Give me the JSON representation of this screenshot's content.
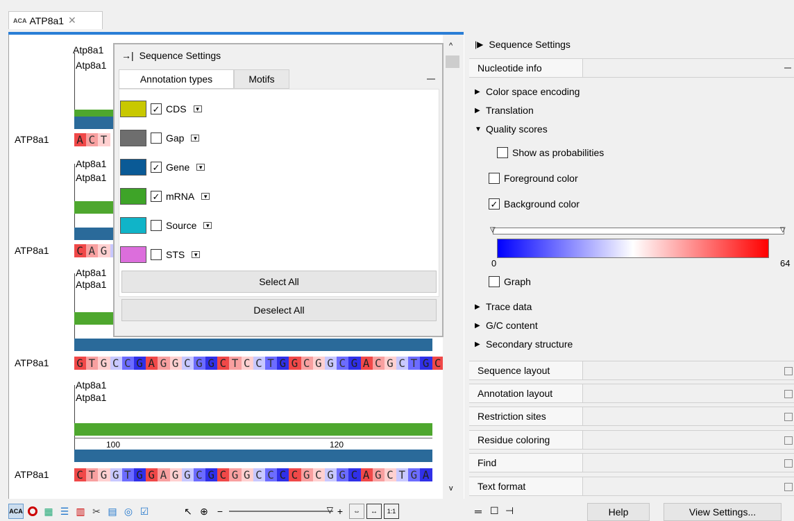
{
  "tab": {
    "title": "ATP8a1",
    "close": "✕",
    "icon_text": "ACA"
  },
  "left": {
    "row1": {
      "ann1": "Atp8a1",
      "ann2": "Atp8a1",
      "seqname": "ATP8a1",
      "residues": [
        "A",
        "C",
        "T"
      ]
    },
    "row2": {
      "ann1": "Atp8a1",
      "ann2": "Atp8a1",
      "seqname": "ATP8a1",
      "residues": [
        "C",
        "A",
        "G",
        "C"
      ]
    },
    "row3": {
      "ann1": "Atp8a1",
      "ann2": "Atp8a1",
      "seqname": "ATP8a1",
      "residues": [
        "G",
        "T",
        "G",
        "C",
        "C",
        "G",
        "A",
        "G",
        "G",
        "C",
        "G",
        "G",
        "C",
        "T",
        "C",
        "C",
        "T",
        "G",
        "G",
        "C",
        "G",
        "G",
        "C",
        "G",
        "A",
        "C",
        "G",
        "C",
        "T",
        "G",
        "C",
        "C"
      ]
    },
    "row4": {
      "ann1": "Atp8a1",
      "ann2": "Atp8a1",
      "tick1": "100",
      "tick2": "120",
      "seqname": "ATP8a1",
      "residues": [
        "C",
        "T",
        "G",
        "G",
        "T",
        "G",
        "G",
        "A",
        "G",
        "G",
        "C",
        "G",
        "C",
        "G",
        "G",
        "C",
        "C",
        "C",
        "C",
        "G",
        "C",
        "G",
        "G",
        "C",
        "A",
        "G",
        "C",
        "T",
        "G",
        "A"
      ]
    }
  },
  "float": {
    "title": "Sequence Settings",
    "tabs": [
      "Annotation types",
      "Motifs"
    ],
    "types": [
      {
        "name": "CDS",
        "checked": true,
        "color": "#c8c800"
      },
      {
        "name": "Gap",
        "checked": false,
        "color": "#6e6e6e"
      },
      {
        "name": "Gene",
        "checked": true,
        "color": "#0a5a96"
      },
      {
        "name": "mRNA",
        "checked": true,
        "color": "#3ea428"
      },
      {
        "name": "Source",
        "checked": false,
        "color": "#10b4c8"
      },
      {
        "name": "STS",
        "checked": false,
        "color": "#dc6edc"
      }
    ],
    "select_all": "Select All",
    "deselect_all": "Deselect All"
  },
  "right": {
    "title": "Sequence Settings",
    "nucleotide_info": "Nucleotide info",
    "color_space": "Color space encoding",
    "translation": "Translation",
    "quality_scores": "Quality scores",
    "show_prob": "Show as probabilities",
    "foreground": "Foreground color",
    "background": "Background color",
    "grad_min": "0",
    "grad_max": "64",
    "graph": "Graph",
    "trace": "Trace data",
    "gc": "G/C content",
    "secondary": "Secondary structure",
    "sections": [
      "Sequence layout",
      "Annotation layout",
      "Restriction sites",
      "Residue coloring",
      "Find",
      "Text format"
    ],
    "help": "Help",
    "view_settings": "View Settings..."
  }
}
